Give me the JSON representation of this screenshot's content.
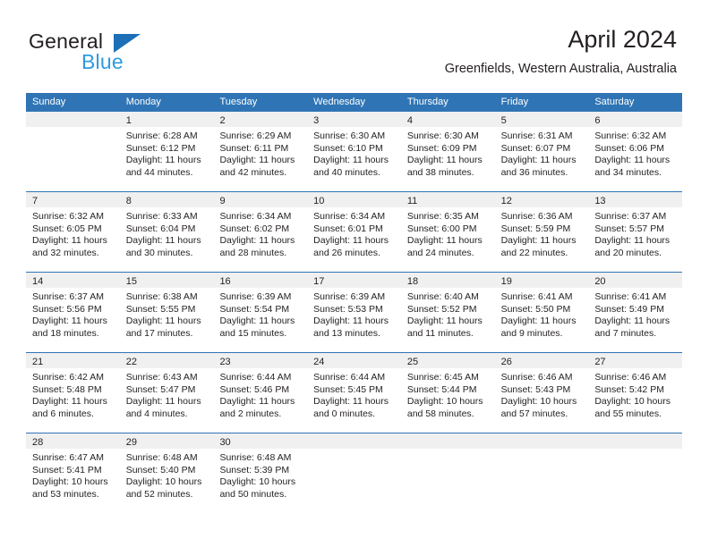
{
  "logo": {
    "word1": "General",
    "word2": "Blue",
    "triangle_color": "#1d6fb8",
    "word2_color": "#2e9bdf"
  },
  "header": {
    "title": "April 2024",
    "subtitle": "Greenfields, Western Australia, Australia"
  },
  "theme": {
    "header_blue": "#2f75b5",
    "daynum_strip": "#f0f0f0",
    "text": "#231f20"
  },
  "weekdays": [
    "Sunday",
    "Monday",
    "Tuesday",
    "Wednesday",
    "Thursday",
    "Friday",
    "Saturday"
  ],
  "weeks": [
    [
      {
        "empty": true
      },
      {
        "day": "1",
        "sunrise": "Sunrise: 6:28 AM",
        "sunset": "Sunset: 6:12 PM",
        "daylight": "Daylight: 11 hours and 44 minutes."
      },
      {
        "day": "2",
        "sunrise": "Sunrise: 6:29 AM",
        "sunset": "Sunset: 6:11 PM",
        "daylight": "Daylight: 11 hours and 42 minutes."
      },
      {
        "day": "3",
        "sunrise": "Sunrise: 6:30 AM",
        "sunset": "Sunset: 6:10 PM",
        "daylight": "Daylight: 11 hours and 40 minutes."
      },
      {
        "day": "4",
        "sunrise": "Sunrise: 6:30 AM",
        "sunset": "Sunset: 6:09 PM",
        "daylight": "Daylight: 11 hours and 38 minutes."
      },
      {
        "day": "5",
        "sunrise": "Sunrise: 6:31 AM",
        "sunset": "Sunset: 6:07 PM",
        "daylight": "Daylight: 11 hours and 36 minutes."
      },
      {
        "day": "6",
        "sunrise": "Sunrise: 6:32 AM",
        "sunset": "Sunset: 6:06 PM",
        "daylight": "Daylight: 11 hours and 34 minutes."
      }
    ],
    [
      {
        "day": "7",
        "sunrise": "Sunrise: 6:32 AM",
        "sunset": "Sunset: 6:05 PM",
        "daylight": "Daylight: 11 hours and 32 minutes."
      },
      {
        "day": "8",
        "sunrise": "Sunrise: 6:33 AM",
        "sunset": "Sunset: 6:04 PM",
        "daylight": "Daylight: 11 hours and 30 minutes."
      },
      {
        "day": "9",
        "sunrise": "Sunrise: 6:34 AM",
        "sunset": "Sunset: 6:02 PM",
        "daylight": "Daylight: 11 hours and 28 minutes."
      },
      {
        "day": "10",
        "sunrise": "Sunrise: 6:34 AM",
        "sunset": "Sunset: 6:01 PM",
        "daylight": "Daylight: 11 hours and 26 minutes."
      },
      {
        "day": "11",
        "sunrise": "Sunrise: 6:35 AM",
        "sunset": "Sunset: 6:00 PM",
        "daylight": "Daylight: 11 hours and 24 minutes."
      },
      {
        "day": "12",
        "sunrise": "Sunrise: 6:36 AM",
        "sunset": "Sunset: 5:59 PM",
        "daylight": "Daylight: 11 hours and 22 minutes."
      },
      {
        "day": "13",
        "sunrise": "Sunrise: 6:37 AM",
        "sunset": "Sunset: 5:57 PM",
        "daylight": "Daylight: 11 hours and 20 minutes."
      }
    ],
    [
      {
        "day": "14",
        "sunrise": "Sunrise: 6:37 AM",
        "sunset": "Sunset: 5:56 PM",
        "daylight": "Daylight: 11 hours and 18 minutes."
      },
      {
        "day": "15",
        "sunrise": "Sunrise: 6:38 AM",
        "sunset": "Sunset: 5:55 PM",
        "daylight": "Daylight: 11 hours and 17 minutes."
      },
      {
        "day": "16",
        "sunrise": "Sunrise: 6:39 AM",
        "sunset": "Sunset: 5:54 PM",
        "daylight": "Daylight: 11 hours and 15 minutes."
      },
      {
        "day": "17",
        "sunrise": "Sunrise: 6:39 AM",
        "sunset": "Sunset: 5:53 PM",
        "daylight": "Daylight: 11 hours and 13 minutes."
      },
      {
        "day": "18",
        "sunrise": "Sunrise: 6:40 AM",
        "sunset": "Sunset: 5:52 PM",
        "daylight": "Daylight: 11 hours and 11 minutes."
      },
      {
        "day": "19",
        "sunrise": "Sunrise: 6:41 AM",
        "sunset": "Sunset: 5:50 PM",
        "daylight": "Daylight: 11 hours and 9 minutes."
      },
      {
        "day": "20",
        "sunrise": "Sunrise: 6:41 AM",
        "sunset": "Sunset: 5:49 PM",
        "daylight": "Daylight: 11 hours and 7 minutes."
      }
    ],
    [
      {
        "day": "21",
        "sunrise": "Sunrise: 6:42 AM",
        "sunset": "Sunset: 5:48 PM",
        "daylight": "Daylight: 11 hours and 6 minutes."
      },
      {
        "day": "22",
        "sunrise": "Sunrise: 6:43 AM",
        "sunset": "Sunset: 5:47 PM",
        "daylight": "Daylight: 11 hours and 4 minutes."
      },
      {
        "day": "23",
        "sunrise": "Sunrise: 6:44 AM",
        "sunset": "Sunset: 5:46 PM",
        "daylight": "Daylight: 11 hours and 2 minutes."
      },
      {
        "day": "24",
        "sunrise": "Sunrise: 6:44 AM",
        "sunset": "Sunset: 5:45 PM",
        "daylight": "Daylight: 11 hours and 0 minutes."
      },
      {
        "day": "25",
        "sunrise": "Sunrise: 6:45 AM",
        "sunset": "Sunset: 5:44 PM",
        "daylight": "Daylight: 10 hours and 58 minutes."
      },
      {
        "day": "26",
        "sunrise": "Sunrise: 6:46 AM",
        "sunset": "Sunset: 5:43 PM",
        "daylight": "Daylight: 10 hours and 57 minutes."
      },
      {
        "day": "27",
        "sunrise": "Sunrise: 6:46 AM",
        "sunset": "Sunset: 5:42 PM",
        "daylight": "Daylight: 10 hours and 55 minutes."
      }
    ],
    [
      {
        "day": "28",
        "sunrise": "Sunrise: 6:47 AM",
        "sunset": "Sunset: 5:41 PM",
        "daylight": "Daylight: 10 hours and 53 minutes."
      },
      {
        "day": "29",
        "sunrise": "Sunrise: 6:48 AM",
        "sunset": "Sunset: 5:40 PM",
        "daylight": "Daylight: 10 hours and 52 minutes."
      },
      {
        "day": "30",
        "sunrise": "Sunrise: 6:48 AM",
        "sunset": "Sunset: 5:39 PM",
        "daylight": "Daylight: 10 hours and 50 minutes."
      },
      {
        "empty": true
      },
      {
        "empty": true
      },
      {
        "empty": true
      },
      {
        "empty": true
      }
    ]
  ]
}
